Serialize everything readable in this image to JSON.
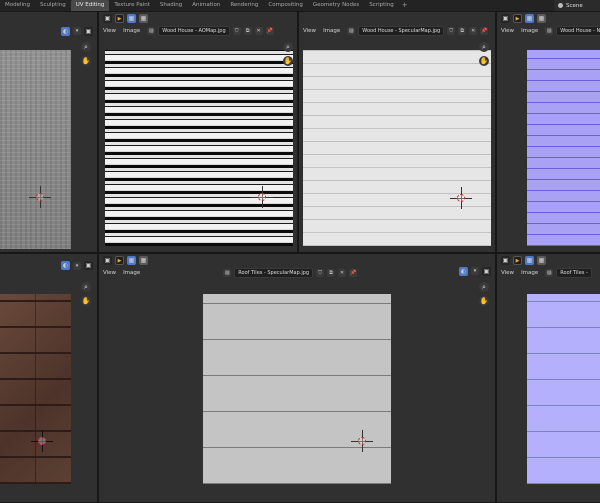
{
  "workspace_tabs": [
    "Modeling",
    "Sculpting",
    "UV Editing",
    "Texture Paint",
    "Shading",
    "Animation",
    "Rendering",
    "Compositing",
    "Geometry Nodes",
    "Scripting"
  ],
  "active_tab": "UV Editing",
  "add_tab_symbol": "+",
  "scene_label": "Scene",
  "panes": {
    "top_center_left": {
      "menu_view": "View",
      "menu_image": "Image",
      "image_name": "Wood House - AOMap.jpg"
    },
    "top_center_right": {
      "menu_view": "View",
      "menu_image": "Image",
      "image_name": "Wood House - SpecularMap.jpg"
    },
    "top_right": {
      "menu_view": "View",
      "menu_image": "Image",
      "image_name": "Wood House - N"
    },
    "bottom_center": {
      "menu_view": "View",
      "menu_image": "Image",
      "image_name": "Roof Tiles - SpecularMap.jpg"
    },
    "bottom_right": {
      "menu_view": "View",
      "menu_image": "Image",
      "image_name": "Roof Tiles -"
    }
  },
  "icons": {
    "editor_type": "image-editor-icon",
    "play": "play-icon",
    "image_browse": "image-icon",
    "pin": "pin-icon",
    "zoom": "zoom-icon",
    "hand": "hand-icon"
  }
}
